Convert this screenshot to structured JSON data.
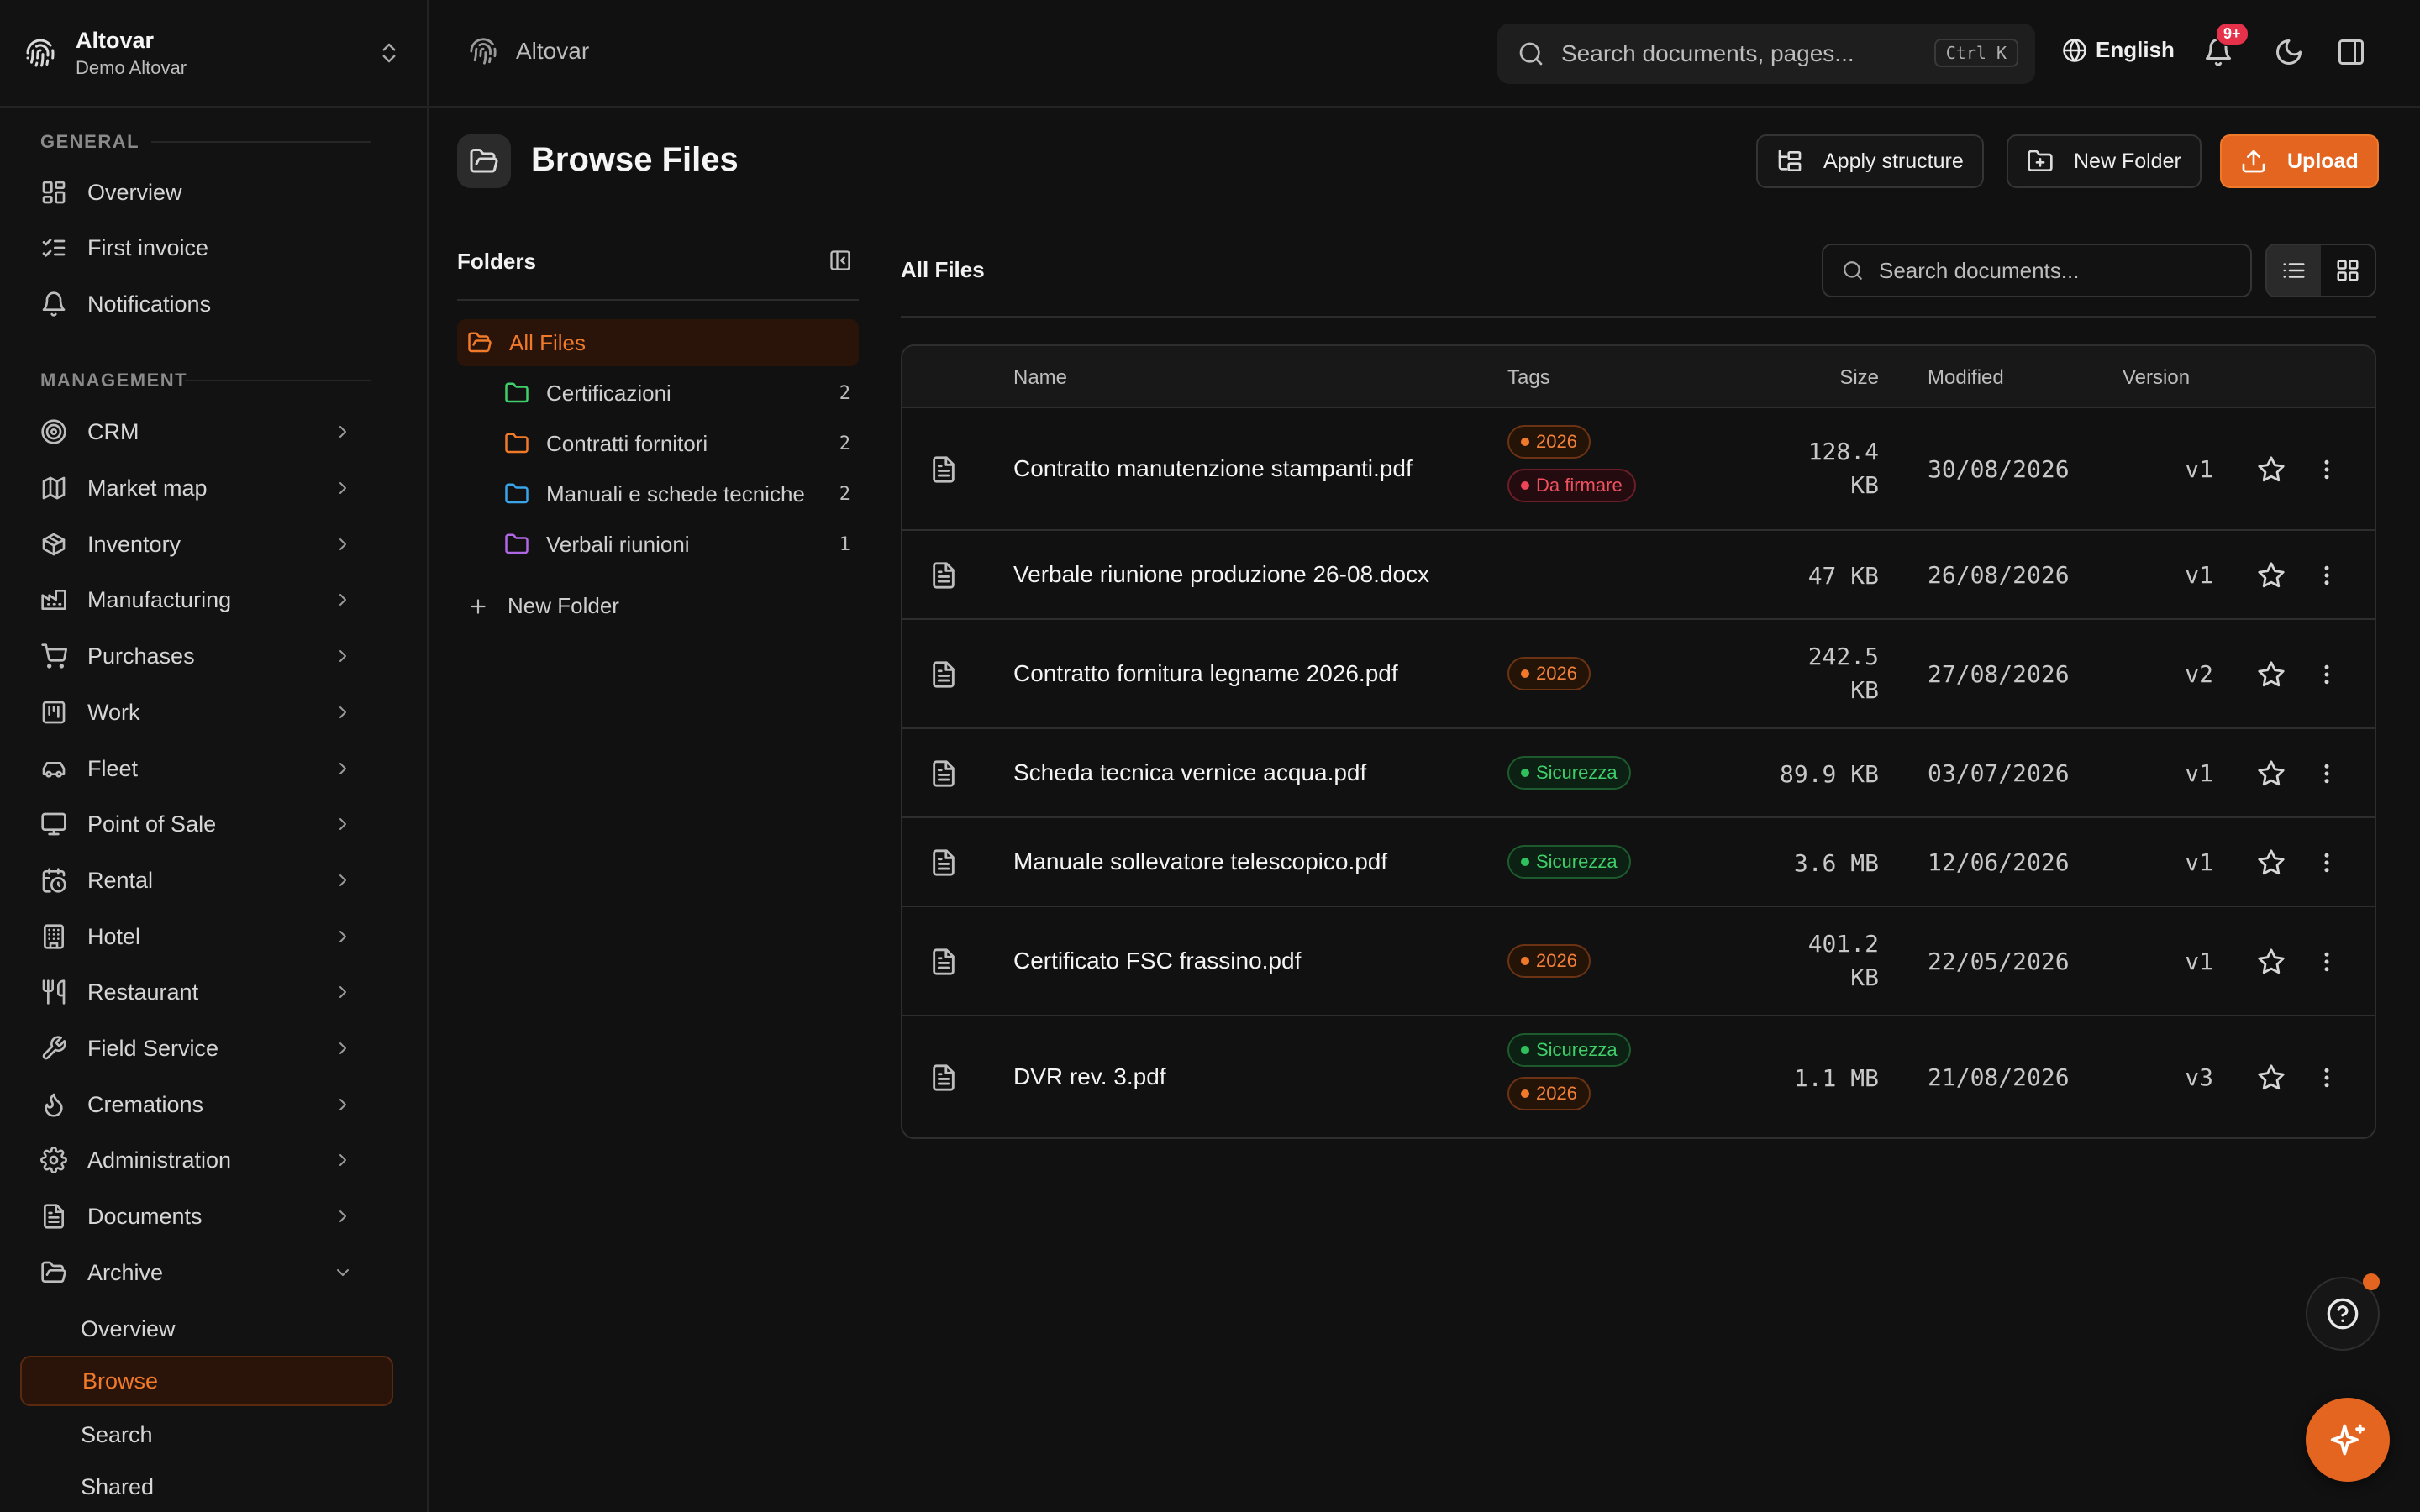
{
  "workspace": {
    "name": "Altovar",
    "subtitle": "Demo Altovar"
  },
  "sidebar": {
    "general_label": "GENERAL",
    "management_label": "MANAGEMENT",
    "general": [
      {
        "label": "Overview",
        "icon": "grid-icon"
      },
      {
        "label": "First invoice",
        "icon": "checklist-icon"
      },
      {
        "label": "Notifications",
        "icon": "bell-icon"
      }
    ],
    "management": [
      {
        "label": "CRM",
        "icon": "target-icon"
      },
      {
        "label": "Market map",
        "icon": "map-icon"
      },
      {
        "label": "Inventory",
        "icon": "box-icon"
      },
      {
        "label": "Manufacturing",
        "icon": "factory-icon"
      },
      {
        "label": "Purchases",
        "icon": "cart-icon"
      },
      {
        "label": "Work",
        "icon": "kanban-icon"
      },
      {
        "label": "Fleet",
        "icon": "car-icon"
      },
      {
        "label": "Point of Sale",
        "icon": "monitor-icon"
      },
      {
        "label": "Rental",
        "icon": "calendar-clock-icon"
      },
      {
        "label": "Hotel",
        "icon": "building-icon"
      },
      {
        "label": "Restaurant",
        "icon": "utensils-icon"
      },
      {
        "label": "Field Service",
        "icon": "wrench-icon"
      },
      {
        "label": "Cremations",
        "icon": "flame-icon"
      },
      {
        "label": "Administration",
        "icon": "gear-icon"
      },
      {
        "label": "Documents",
        "icon": "document-icon"
      },
      {
        "label": "Archive",
        "icon": "folder-open-icon"
      }
    ],
    "archive_sub": [
      {
        "label": "Overview"
      },
      {
        "label": "Browse"
      },
      {
        "label": "Search"
      },
      {
        "label": "Shared"
      }
    ]
  },
  "topbar": {
    "breadcrumb": "Altovar",
    "search_placeholder": "Search documents, pages...",
    "shortcut": "Ctrl K",
    "language": "English",
    "notification_count": "9+"
  },
  "page": {
    "title": "Browse Files",
    "apply_structure": "Apply structure",
    "new_folder": "New Folder",
    "upload": "Upload"
  },
  "folders_panel": {
    "title": "Folders",
    "all_files": "All Files",
    "new_folder": "New Folder",
    "folders": [
      {
        "name": "Certificazioni",
        "count": "2",
        "color": "#3fcf6a"
      },
      {
        "name": "Contratti fornitori",
        "count": "2",
        "color": "#f07a2a"
      },
      {
        "name": "Manuali e schede tecniche",
        "count": "2",
        "color": "#3ba4e8"
      },
      {
        "name": "Verbali riunioni",
        "count": "1",
        "color": "#b067e6"
      }
    ]
  },
  "files": {
    "title": "All Files",
    "search_placeholder": "Search documents...",
    "columns": {
      "name": "Name",
      "tags": "Tags",
      "size": "Size",
      "modified": "Modified",
      "version": "Version"
    },
    "rows": [
      {
        "name": "Contratto manutenzione stampanti.pdf",
        "tags": [
          {
            "label": "2026",
            "tone": "orange"
          },
          {
            "label": "Da firmare",
            "tone": "red"
          }
        ],
        "size": [
          "128.4",
          "KB"
        ],
        "modified": "30/08/2026",
        "version": "v1"
      },
      {
        "name": "Verbale riunione produzione 26-08.docx",
        "tags": [],
        "size": [
          "47 KB"
        ],
        "modified": "26/08/2026",
        "version": "v1"
      },
      {
        "name": "Contratto fornitura legname 2026.pdf",
        "tags": [
          {
            "label": "2026",
            "tone": "orange"
          }
        ],
        "size": [
          "242.5",
          "KB"
        ],
        "modified": "27/08/2026",
        "version": "v2"
      },
      {
        "name": "Scheda tecnica vernice acqua.pdf",
        "tags": [
          {
            "label": "Sicurezza",
            "tone": "green"
          }
        ],
        "size": [
          "89.9 KB"
        ],
        "modified": "03/07/2026",
        "version": "v1"
      },
      {
        "name": "Manuale sollevatore telescopico.pdf",
        "tags": [
          {
            "label": "Sicurezza",
            "tone": "green"
          }
        ],
        "size": [
          "3.6 MB"
        ],
        "modified": "12/06/2026",
        "version": "v1"
      },
      {
        "name": "Certificato FSC frassino.pdf",
        "tags": [
          {
            "label": "2026",
            "tone": "orange"
          }
        ],
        "size": [
          "401.2",
          "KB"
        ],
        "modified": "22/05/2026",
        "version": "v1"
      },
      {
        "name": "DVR rev. 3.pdf",
        "tags": [
          {
            "label": "Sicurezza",
            "tone": "green"
          },
          {
            "label": "2026",
            "tone": "orange"
          }
        ],
        "size": [
          "1.1 MB"
        ],
        "modified": "21/08/2026",
        "version": "v3"
      }
    ]
  },
  "colors": {
    "accent": "#e4651f",
    "background": "#111111",
    "active_bg": "#2a1409"
  }
}
